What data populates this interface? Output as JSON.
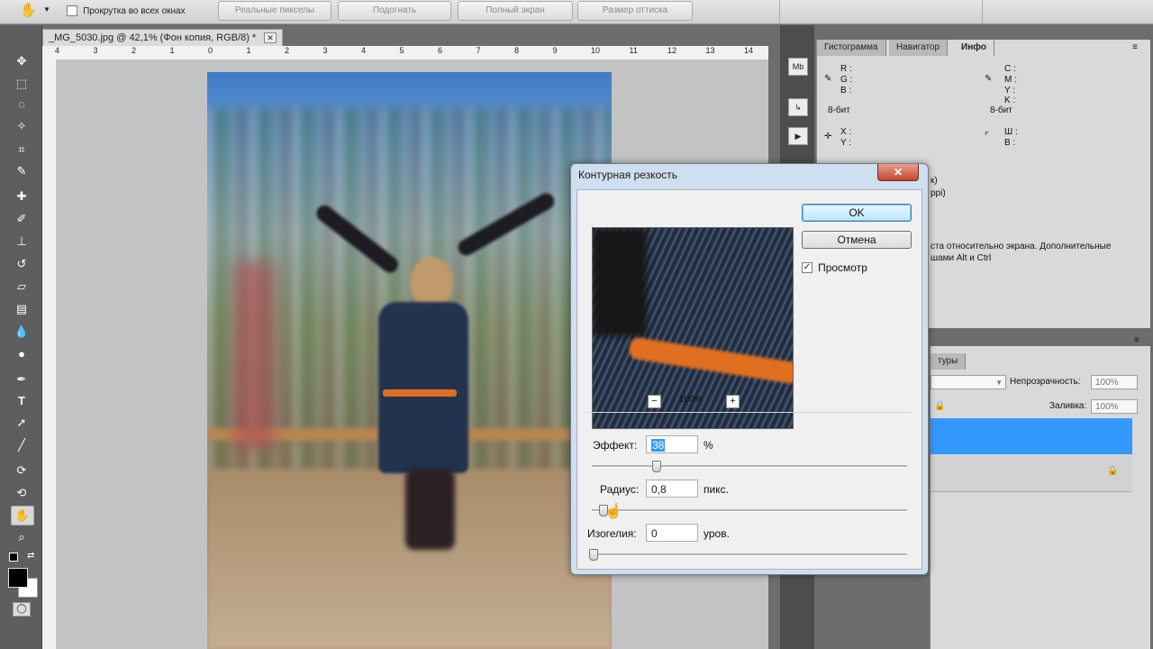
{
  "options_bar": {
    "scroll_all_label": "Прокрутка во всех окнах",
    "buttons": [
      "Реальные пикселы",
      "Подогнать",
      "Полный экран",
      "Размер оттиска"
    ]
  },
  "document": {
    "tab_title": "_MG_5030.jpg @ 42,1% (Фон копия, RGB/8) *",
    "ruler_ticks": [
      "4",
      "3",
      "2",
      "1",
      "0",
      "1",
      "2",
      "3",
      "4",
      "5",
      "6",
      "7",
      "8",
      "9",
      "10",
      "11",
      "12",
      "13",
      "14"
    ]
  },
  "info_panel": {
    "tabs": [
      "Гистограмма",
      "Навигатор",
      "Инфо"
    ],
    "rgb_labels": [
      "R :",
      "G :",
      "B :"
    ],
    "cmyk_labels": [
      "C :",
      "M :",
      "Y :",
      "K :"
    ],
    "bit_left": "8-бит",
    "bit_right": "8-бит",
    "xy_labels": [
      "X :",
      "Y :"
    ],
    "wh_labels": [
      "Ш :",
      "В :"
    ],
    "partial_1": "к)",
    "partial_2": "ppi)",
    "hint_line1": "ста относительно экрана. Дополнительные",
    "hint_line2": "шами Alt и Ctrl"
  },
  "layers_panel": {
    "tab_partial": "туры",
    "opacity_label": "Непрозрачность:",
    "opacity_value": "100%",
    "fill_label": "Заливка:",
    "fill_value": "100%"
  },
  "dialog": {
    "title": "Контурная резкость",
    "close": "✕",
    "ok": "OK",
    "cancel": "Отмена",
    "preview_label": "Просмотр",
    "preview_checked": true,
    "zoom_out": "−",
    "zoom_in": "+",
    "zoom_value": "100%",
    "amount_label": "Эффект:",
    "amount_value": "38",
    "amount_unit": "%",
    "radius_label": "Радиус:",
    "radius_value": "0,8",
    "radius_unit": "пикс.",
    "threshold_label": "Изогелия:",
    "threshold_value": "0",
    "threshold_unit": "уров."
  },
  "colors": {
    "selection_blue": "#3399ff",
    "belt_orange": "#e07020",
    "dress_navy": "#22324f"
  }
}
